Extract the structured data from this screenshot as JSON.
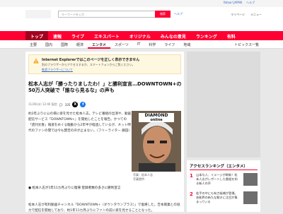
{
  "topbar": {
    "links": [
      "Yahoo! JAPAN",
      "ヘルプ"
    ]
  },
  "header": {
    "search_placeholder": "キーワードを入力",
    "search_button": "検索",
    "help": "ヘルプ",
    "mypage": "マイページ",
    "menu": "メニュー"
  },
  "nav": {
    "main": [
      "トップ",
      "速報",
      "ライブ",
      "エキスパート",
      "オリジナル",
      "みんなの意見",
      "ランキング",
      "有料"
    ],
    "sub": [
      "主要",
      "国内",
      "国際",
      "経済",
      "エンタメ",
      "スポーツ",
      "IT",
      "科学",
      "ライフ",
      "地域"
    ],
    "topics": "トピックス一覧"
  },
  "notice": {
    "title": "Internet Explorerではこのページを正しく表示できません",
    "desc": "別のブラウザーからアクセスするか、スマートフォンからご覧ください。",
    "link": "推奨ブラウザーについて"
  },
  "article": {
    "title": "松本人志が「勝ったりましたわ！」と勝利宣言…DOWNTOWN+の50万人突破で「誰なら見るな」の声も",
    "date": "11/26(水) 12:40 配信",
    "comment_count": "335",
    "body1": "約2年ぶりに公の場に姿を見せた松本人志。テレビ番組の出演や、動画配信サービス「DOWNTOWN+」を開始したことを報告。かつての「週刊文春」報道をめぐる騒動から2年半が経過しているが、ネット時代のファンの間では今も賛否の声が止まない。（フリーライター 藤田）",
    "bullet": "松本人志が1年11カ月ぶりに復帰 登録者数の多さに勝利宣言",
    "body2": "松本人志が有料動画チャンネル「DOWNTOWN+（ダウンタウンプラス）」で復帰した。吉本興業との協力で配信を開始しており、約1年11カ月ぶりにファンの前に姿を見せることとなった。",
    "photo_brand": "DIAMOND",
    "photo_brand2": "online",
    "caption1": "写真：松本人志",
    "caption2": "写真提供"
  },
  "sidebar": {
    "access_title": "アクセスランキング（エンタメ）",
    "ranks": [
      {
        "num": "1",
        "text": "山本与人、イメージが刷新！松本人志がレポートした番組を知る新人の声"
      },
      {
        "num": "2",
        "text": "若手の中にも有力候補が登場。芸能界の新たな動きに注目が集まっている"
      }
    ]
  },
  "colors": {
    "accent": "#ff0033",
    "link": "#3366cc"
  }
}
